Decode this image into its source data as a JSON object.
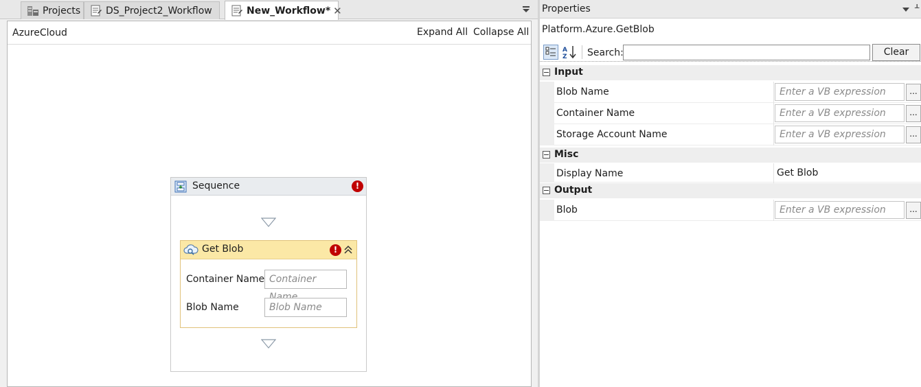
{
  "tabs": [
    {
      "label": "Projects",
      "active": false
    },
    {
      "label": "DS_Project2_Workflow",
      "active": false
    },
    {
      "label": "New_Workflow*",
      "active": true
    }
  ],
  "designer": {
    "breadcrumb": "AzureCloud",
    "expand_all": "Expand All",
    "collapse_all": "Collapse All",
    "sequence": {
      "title": "Sequence",
      "error": "!",
      "activity": {
        "title": "Get Blob",
        "error": "!",
        "fields": [
          {
            "label": "Container Name",
            "placeholder": "Container Name"
          },
          {
            "label": "Blob Name",
            "placeholder": "Blob Name"
          }
        ]
      }
    }
  },
  "properties": {
    "title": "Properties",
    "activity_type": "Platform.Azure.GetBlob",
    "search_label": "Search:",
    "search_value": "",
    "clear_label": "Clear",
    "categories": [
      {
        "name": "Input",
        "rows": [
          {
            "name": "Blob Name",
            "placeholder": "Enter a VB expression",
            "ellipsis": "..."
          },
          {
            "name": "Container Name",
            "placeholder": "Enter a VB expression",
            "ellipsis": "..."
          },
          {
            "name": "Storage Account Name",
            "placeholder": "Enter a VB expression",
            "ellipsis": "..."
          }
        ]
      },
      {
        "name": "Misc",
        "rows": [
          {
            "name": "Display Name",
            "value": "Get Blob"
          }
        ]
      },
      {
        "name": "Output",
        "rows": [
          {
            "name": "Blob",
            "placeholder": "Enter a VB expression",
            "ellipsis": "..."
          }
        ]
      }
    ]
  },
  "colors": {
    "activity_header": "#fbe8a6",
    "error": "#c00000",
    "sequence_header": "#e9ecef"
  }
}
